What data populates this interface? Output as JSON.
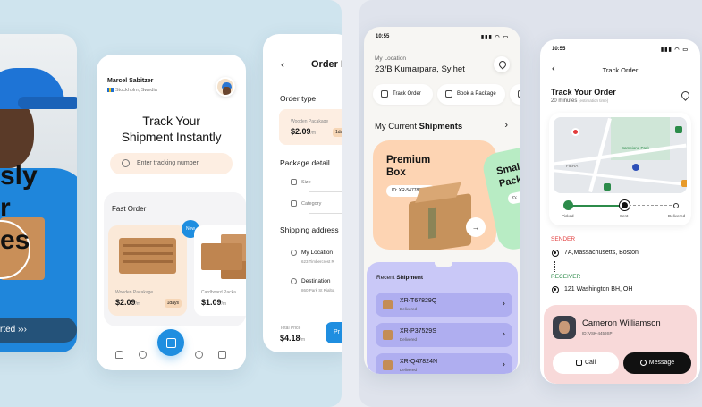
{
  "screen_a": {
    "headline_lines": [
      "sly",
      "r",
      "es"
    ],
    "cta": "rted ›››"
  },
  "screen_b": {
    "user_name": "Marcel Sabitzer",
    "user_location": "Stockholm, Swedia",
    "hero_title_line1": "Track Your",
    "hero_title_line2": "Shipment Instantly",
    "search_placeholder": "Enter tracking number",
    "fast_order_title": "Fast Order",
    "new_badge": "New",
    "products": [
      {
        "name": "Wooden Pacakage",
        "price": "$2.09",
        "unit": "/m",
        "days": "1days"
      },
      {
        "name": "Cardboard Packa",
        "price": "$1.09",
        "unit": "/m",
        "days": ""
      }
    ]
  },
  "screen_c": {
    "title": "Order I",
    "order_type_label": "Order type",
    "package_name": "Wooden Pacakage",
    "package_price": "$2.09",
    "package_unit": "/m",
    "package_days": "1da",
    "package_detail_label": "Package detail",
    "size_label": "Size",
    "category_label": "Category",
    "shipping_label": "Shipping address",
    "my_location_label": "My Location",
    "my_location_value": "623 Timbercrest R",
    "destination_label": "Destination",
    "destination_value": "860 Park St Rialto,",
    "total_label": "Total Price",
    "total_value": "$4.18",
    "total_unit": "/m",
    "pay_label": "Pr"
  },
  "screen_d": {
    "time": "10:55",
    "status_icons": "▮▮▮ ◠ ▭",
    "location_label": "My Location",
    "location_value": "23/B Kumarpara, Sylhet",
    "pills": [
      "Track Order",
      "Book a Package",
      ""
    ],
    "current_shipments_pre": "My Current ",
    "current_shipments_bold": "Shipments",
    "premium_title_line1": "Premium",
    "premium_title_line2": "Box",
    "premium_id": "ID: XR-547785ART",
    "small_title_line1": "Smal",
    "small_title_line2": "Pack",
    "small_id": "ID:",
    "recent_pre": "Recent ",
    "recent_bold": "Shipment",
    "shipments": [
      {
        "id": "XR-T67829Q",
        "status": "Delivered"
      },
      {
        "id": "XR-P37529S",
        "status": "Delivered"
      },
      {
        "id": "XR-Q47824N",
        "status": "Delivered"
      }
    ]
  },
  "screen_e": {
    "time": "10:55",
    "status_icons": "▮▮▮ ◠ ▭",
    "header": "Track Order",
    "title": "Track Your Order",
    "eta": "20 minutes",
    "eta_note": "(estimation time)",
    "map_labels": [
      "Sampione Park",
      "FIERA"
    ],
    "steps": [
      "Picked",
      "Sent",
      "Delivered"
    ],
    "sender_label": "SENDER",
    "sender_address": "7A,Massachusetts, Boston",
    "receiver_label": "RECEIVER",
    "receiver_address": "121 Washington BH, OH",
    "courier_name": "Cameron Williamson",
    "courier_id": "ID: VSK-4459SP",
    "call_label": "Call",
    "message_label": "Message"
  },
  "colors": {
    "accent_blue": "#1f8ee0",
    "peach": "#fdd4b3",
    "lavender": "#c9c8f7",
    "mint": "#b8ecc4",
    "sender_red": "#e23b3b",
    "receiver_green": "#2c8b4a"
  }
}
